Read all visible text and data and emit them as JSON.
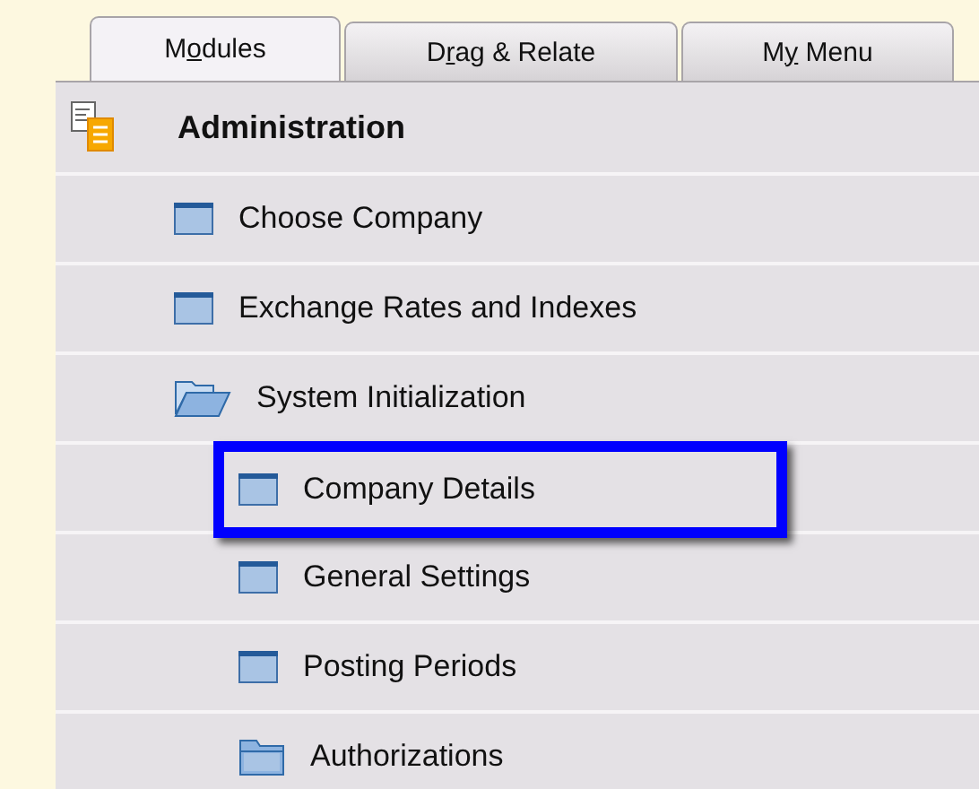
{
  "tabs": [
    {
      "label_parts": [
        {
          "text": "M",
          "underlined": false
        },
        {
          "text": "o",
          "underlined": true
        },
        {
          "text": "dules",
          "underlined": false
        }
      ],
      "selected": true
    },
    {
      "label_parts": [
        {
          "text": "D",
          "underlined": false
        },
        {
          "text": "r",
          "underlined": true
        },
        {
          "text": "ag & Relate",
          "underlined": false
        }
      ],
      "selected": false
    },
    {
      "label_parts": [
        {
          "text": "M",
          "underlined": false
        },
        {
          "text": "y",
          "underlined": true
        },
        {
          "text": " Menu",
          "underlined": false
        }
      ],
      "selected": false
    }
  ],
  "module": {
    "title": "Administration"
  },
  "tree": [
    {
      "label": "Choose Company",
      "kind": "window",
      "highlighted": false
    },
    {
      "label": "Exchange Rates and Indexes",
      "kind": "window",
      "highlighted": false
    },
    {
      "label": "System Initialization",
      "kind": "folder",
      "expanded": true,
      "highlighted": false,
      "children": [
        {
          "label": "Company Details",
          "kind": "window",
          "highlighted": true
        },
        {
          "label": "General Settings",
          "kind": "window",
          "highlighted": false
        },
        {
          "label": "Posting Periods",
          "kind": "window",
          "highlighted": false
        },
        {
          "label": "Authorizations",
          "kind": "folder",
          "expanded": false,
          "highlighted": false
        }
      ]
    }
  ]
}
